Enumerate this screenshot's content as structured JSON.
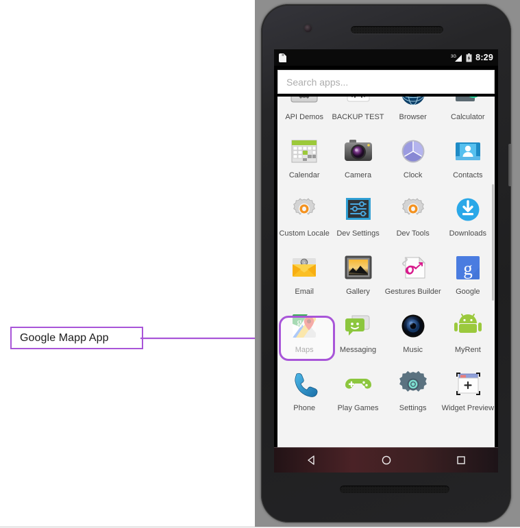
{
  "annotation": {
    "label": "Google Mapp App",
    "accent_color": "#a855d8",
    "target": "maps"
  },
  "device": {
    "body_color": "#232323",
    "backdrop_color": "#8e8e8e",
    "camera_icon": "front-camera-icon",
    "earpiece_icon": "speaker-grille-icon",
    "side_button": "power-button"
  },
  "status_bar": {
    "notification_icon": "sd-card-icon",
    "network_label": "3G",
    "signal_icon": "signal-bars-icon",
    "battery_icon": "battery-charging-icon",
    "time": "8:29"
  },
  "search": {
    "placeholder": "Search apps...",
    "value": "",
    "icon": "search-input"
  },
  "app_drawer": {
    "scrollbar": "app-list-scrollbar",
    "apps": [
      {
        "label": "API Demos",
        "icon": "api-demos-icon"
      },
      {
        "label": "BACKUP TEST",
        "icon": "backup-test-icon"
      },
      {
        "label": "Browser",
        "icon": "browser-icon"
      },
      {
        "label": "Calculator",
        "icon": "calculator-icon"
      },
      {
        "label": "Calendar",
        "icon": "calendar-icon"
      },
      {
        "label": "Camera",
        "icon": "camera-icon"
      },
      {
        "label": "Clock",
        "icon": "clock-icon"
      },
      {
        "label": "Contacts",
        "icon": "contacts-icon"
      },
      {
        "label": "Custom Locale",
        "icon": "custom-locale-icon"
      },
      {
        "label": "Dev Settings",
        "icon": "dev-settings-icon"
      },
      {
        "label": "Dev Tools",
        "icon": "dev-tools-icon"
      },
      {
        "label": "Downloads",
        "icon": "downloads-icon"
      },
      {
        "label": "Email",
        "icon": "email-icon"
      },
      {
        "label": "Gallery",
        "icon": "gallery-icon"
      },
      {
        "label": "Gestures Builder",
        "icon": "gestures-builder-icon"
      },
      {
        "label": "Google",
        "icon": "google-icon"
      },
      {
        "label": "Maps",
        "icon": "maps-icon"
      },
      {
        "label": "Messaging",
        "icon": "messaging-icon"
      },
      {
        "label": "Music",
        "icon": "music-icon"
      },
      {
        "label": "MyRent",
        "icon": "myrent-icon"
      },
      {
        "label": "Phone",
        "icon": "phone-icon"
      },
      {
        "label": "Play Games",
        "icon": "play-games-icon"
      },
      {
        "label": "Settings",
        "icon": "settings-icon"
      },
      {
        "label": "Widget Preview",
        "icon": "widget-preview-icon"
      }
    ]
  },
  "nav_bar": {
    "back": "back-button",
    "home": "home-button",
    "recents": "recents-button"
  }
}
